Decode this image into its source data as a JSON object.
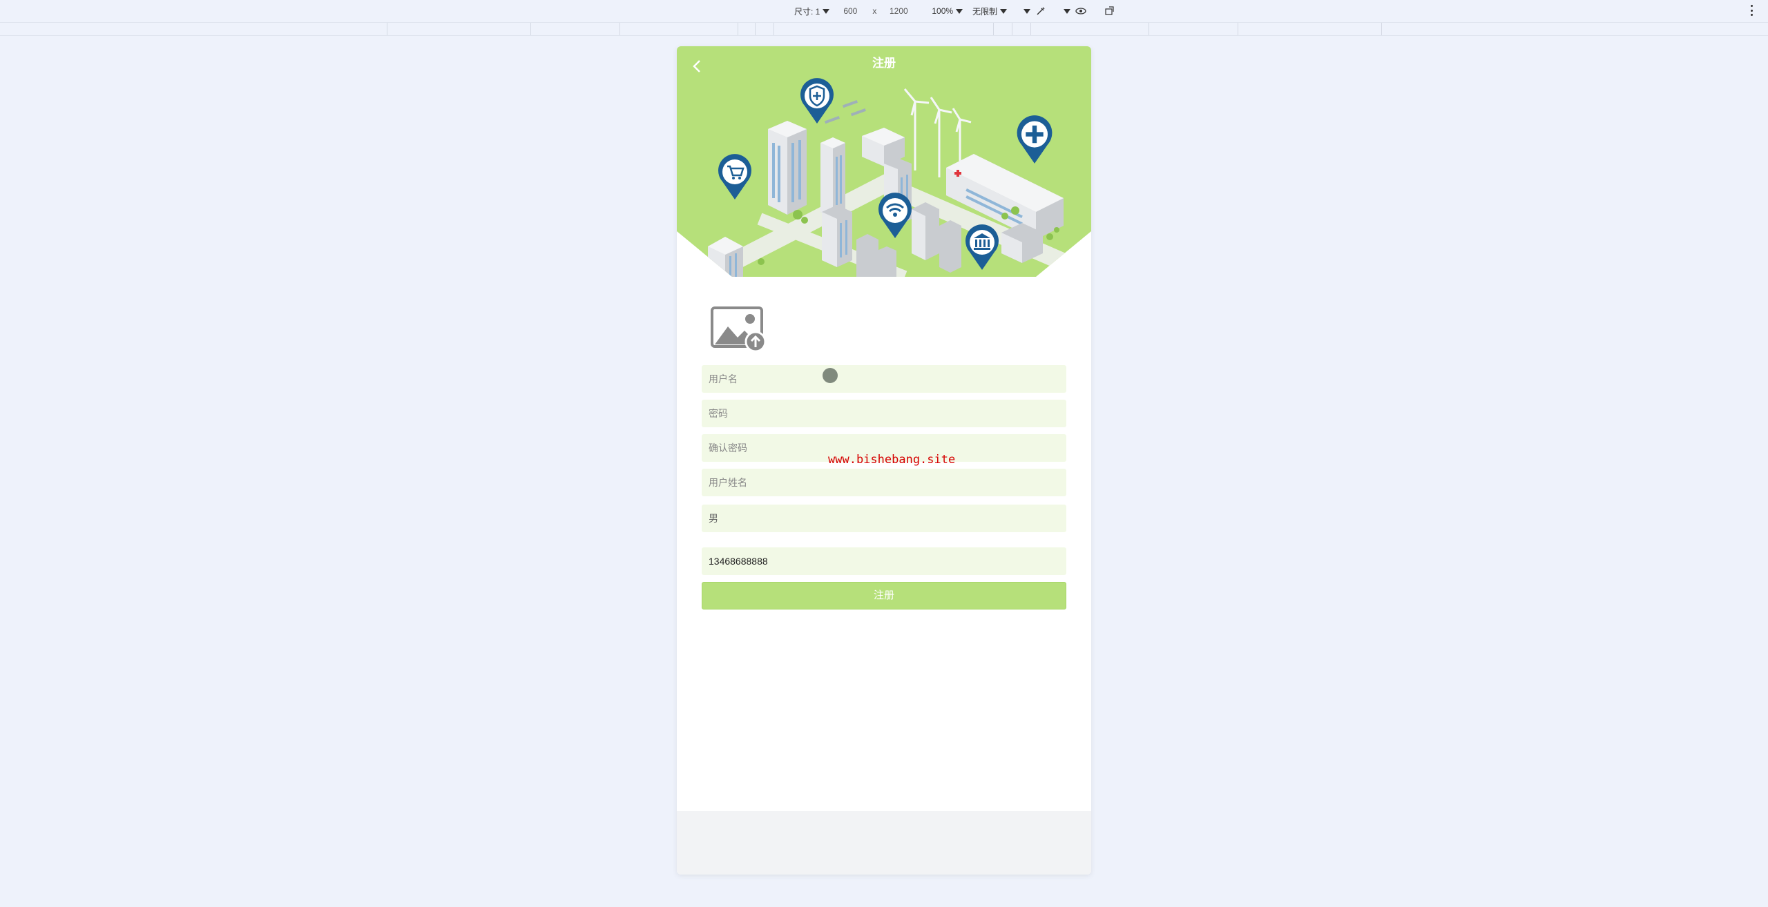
{
  "devtools": {
    "dimensions_label": "尺寸: 1",
    "width": "600",
    "times": "x",
    "height": "1200",
    "zoom": "100%",
    "throttle": "无限制"
  },
  "page": {
    "title": "注册",
    "watermark": "www.bishebang.site"
  },
  "form": {
    "username_placeholder": "用户名",
    "password_placeholder": "密码",
    "confirm_password_placeholder": "确认密码",
    "name_placeholder": "用户姓名",
    "gender_value": "男",
    "phone_value": "13468688888",
    "submit_label": "注册"
  },
  "colors": {
    "accent": "#b6e07a",
    "field_bg": "#f2f9e6",
    "pin": "#1c5e96",
    "watermark": "#d60000"
  }
}
